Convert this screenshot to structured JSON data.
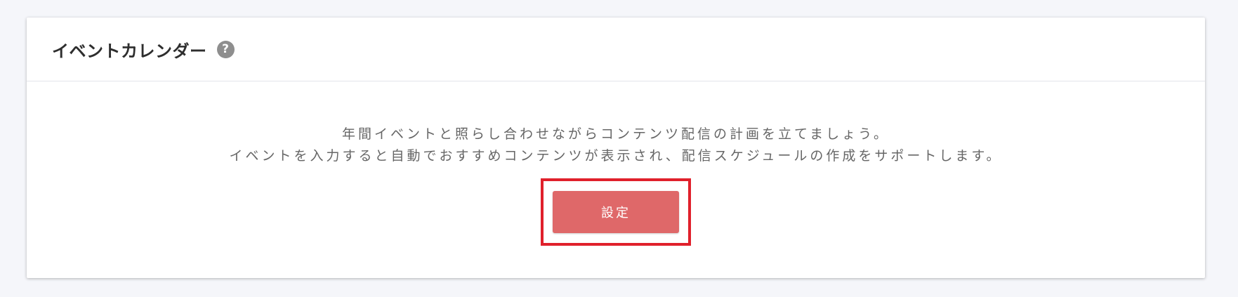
{
  "event_calendar": {
    "title": "イベントカレンダー",
    "help_icon_glyph": "?",
    "description": [
      "年間イベントと照らし合わせながらコンテンツ配信の計画を立てましょう。",
      "イベントを入力すると自動でおすすめコンテンツが表示され、配信スケジュールの作成をサポートします。"
    ],
    "button_label": "設定"
  },
  "colors": {
    "background": "#f5f6fa",
    "card": "#ffffff",
    "button": "#df6869",
    "highlight_border": "#e0202b",
    "help_icon": "#8e8e8e"
  },
  "icons": {
    "help": "question-circle-icon"
  }
}
